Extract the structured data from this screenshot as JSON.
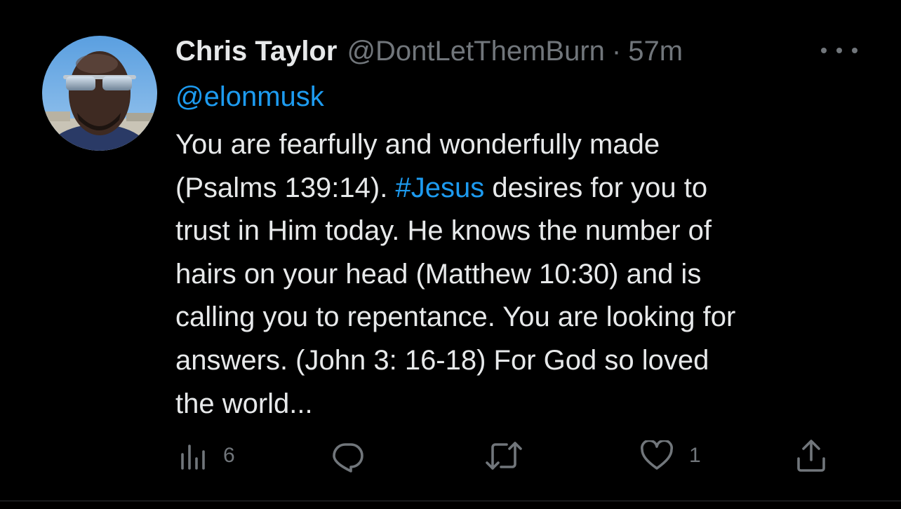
{
  "tweet": {
    "display_name": "Chris Taylor",
    "handle": "@DontLetThemBurn",
    "separator": "·",
    "time": "57m",
    "reply_to": "@elonmusk",
    "body": {
      "line1": " You are fearfully and wonderfully made",
      "line2_before": "(Psalms 139:14). ",
      "hashtag": "#Jesus",
      "line2_after": " desires for you to",
      "line3": "trust in Him today. He knows the number of",
      "line4": "hairs on your head (Matthew 10:30) and is",
      "line5": "calling you to repentance. You are looking for",
      "line6": "answers. (John 3: 16-18) For God so loved",
      "line7": "the world..."
    },
    "actions": {
      "views_icon": "analytics-bars-icon",
      "views_count": "6",
      "reply_icon": "reply-bubble-icon",
      "retweet_icon": "retweet-icon",
      "like_icon": "heart-icon",
      "like_count": "1",
      "share_icon": "share-icon"
    }
  },
  "colors": {
    "background": "#000000",
    "text_primary": "#e7e9ea",
    "text_secondary": "#71767b",
    "accent": "#1d9bf0"
  }
}
